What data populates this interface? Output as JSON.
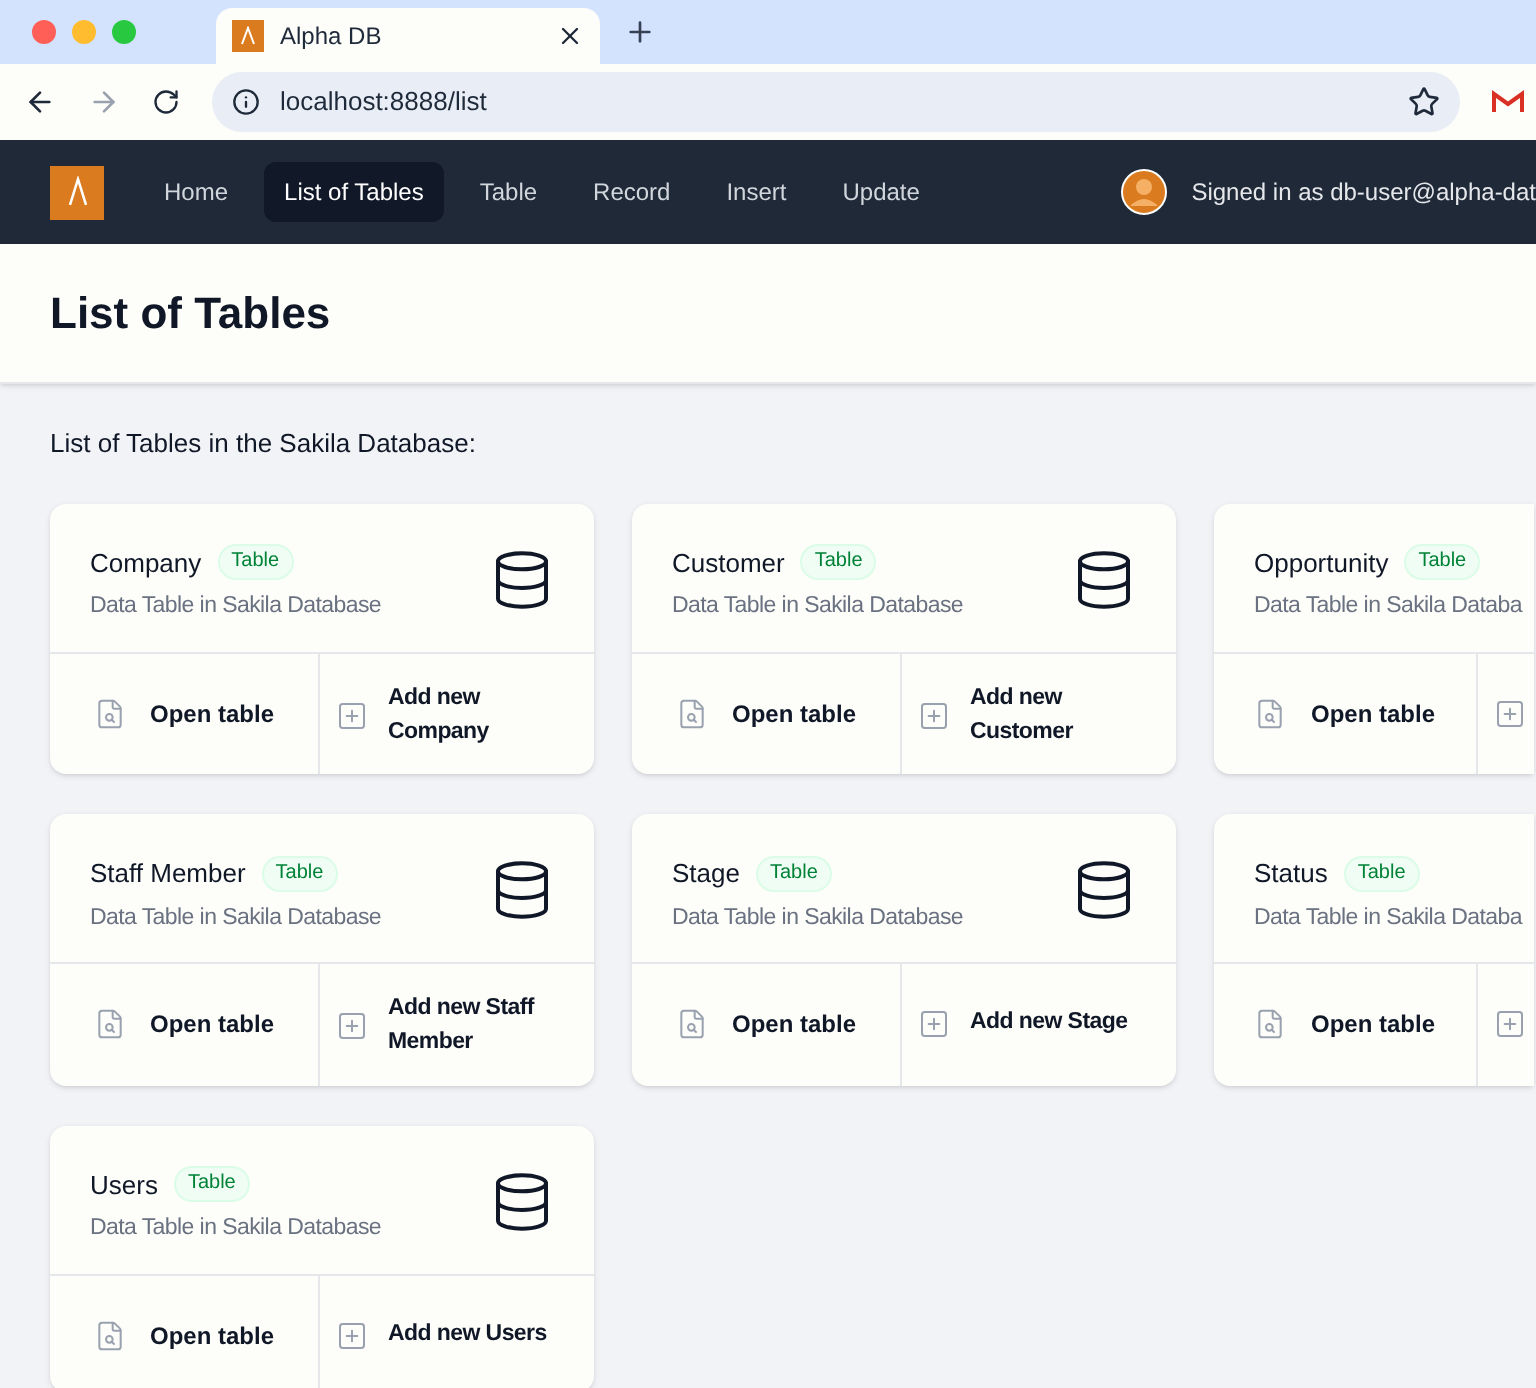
{
  "browser": {
    "tab_title": "Alpha DB",
    "url": "localhost:8888/list"
  },
  "navbar": {
    "items": [
      {
        "label": "Home",
        "selected": false
      },
      {
        "label": "List of Tables",
        "selected": true
      },
      {
        "label": "Table",
        "selected": false
      },
      {
        "label": "Record",
        "selected": false
      },
      {
        "label": "Insert",
        "selected": false
      },
      {
        "label": "Update",
        "selected": false
      }
    ],
    "user": "Signed in as db-user@alpha-dat"
  },
  "page": {
    "title": "List of Tables",
    "intro": "List of Tables in the Sakila Database:"
  },
  "cards": [
    {
      "name": "Company",
      "badge": "Table",
      "description": "Data Table in Sakila Database",
      "open": "Open table",
      "add": "Add new Company"
    },
    {
      "name": "Customer",
      "badge": "Table",
      "description": "Data Table in Sakila Database",
      "open": "Open table",
      "add": "Add new Customer"
    },
    {
      "name": "Opportunity",
      "badge": "Table",
      "description": "Data Table in Sakila Databa",
      "open": "Open table"
    },
    {
      "name": "Staff Member",
      "badge": "Table",
      "description": "Data Table in Sakila Database",
      "open": "Open table",
      "add": "Add new Staff Member"
    },
    {
      "name": "Stage",
      "badge": "Table",
      "description": "Data Table in Sakila Database",
      "open": "Open table",
      "add": "Add new Stage"
    },
    {
      "name": "Status",
      "badge": "Table",
      "description": "Data Table in Sakila Databa",
      "open": "Open table"
    },
    {
      "name": "Users",
      "badge": "Table",
      "description": "Data Table in Sakila Database",
      "open": "Open table",
      "add": "Add new Users"
    }
  ]
}
